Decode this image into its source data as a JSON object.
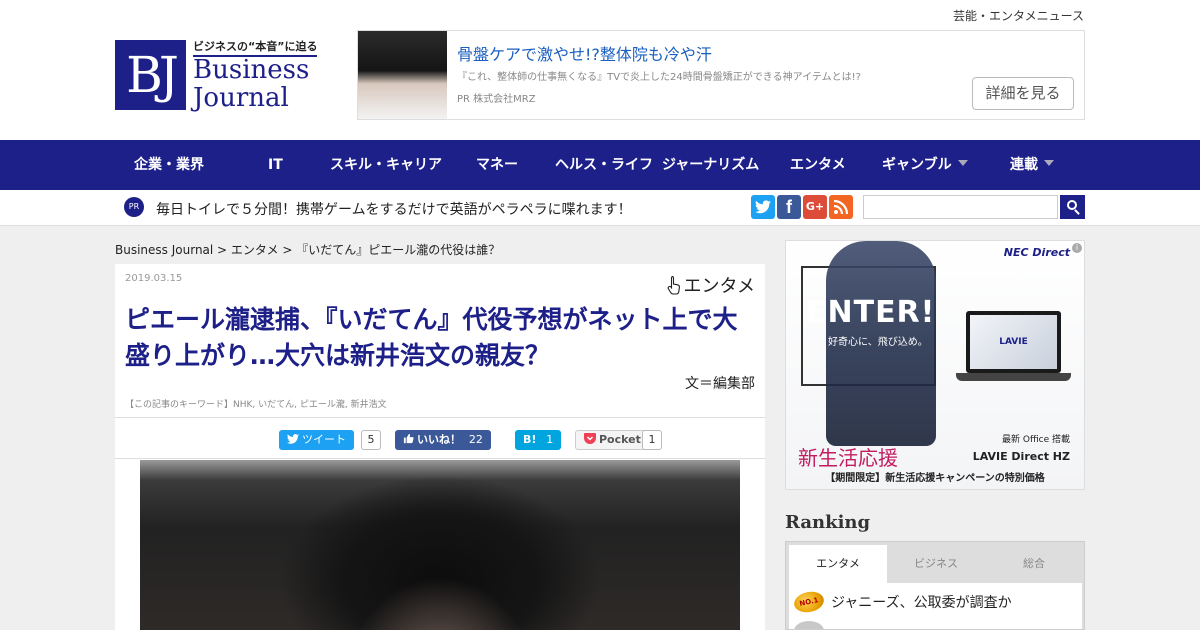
{
  "header": {
    "top_link": "芸能・エンタメニュース",
    "logo": {
      "mark": "BJ",
      "tagline": "ビジネスの“本音”に迫る",
      "name_line1": "Business",
      "name_line2": "Journal"
    }
  },
  "top_ad": {
    "headline": "骨盤ケアで激やせ!?整体院も冷や汗",
    "description": "『これ、整体師の仕事無くなる』TVで炎上した24時間骨盤矯正ができる神アイテムとは!?",
    "advertiser": "PR  株式会社MRZ",
    "button": "詳細を見る"
  },
  "nav": {
    "items": [
      {
        "label": "企業・業界"
      },
      {
        "label": "IT"
      },
      {
        "label": "スキル・キャリア"
      },
      {
        "label": "マネー"
      },
      {
        "label": "ヘルス・ライフ"
      },
      {
        "label": "ジャーナリズム"
      },
      {
        "label": "エンタメ"
      },
      {
        "label": "ギャンブル"
      },
      {
        "label": "連載"
      }
    ]
  },
  "subbar": {
    "pr_badge": "PR",
    "pr_text": "毎日トイレで５分間！携帯ゲームをするだけで英語がペラペラに喋れます！",
    "social": {
      "twitter": "t",
      "facebook": "f",
      "googleplus": "G+",
      "rss": "rss"
    },
    "search_placeholder": ""
  },
  "breadcrumb": "Business Journal  > エンタメ  >  『いだてん』ピエール瀧の代役は誰？",
  "article": {
    "date": "2019.03.15",
    "category": "エンタメ",
    "title": "ピエール瀧逮捕、『いだてん』代役予想がネット上で大盛り上がり…大穴は新井浩文の親友？",
    "byline": "文＝編集部",
    "keywords": "【この記事のキーワード】NHK, いだてん, ピエール瀧, 新井浩文",
    "share": {
      "tweet_label": "ツイート",
      "tweet_count": "5",
      "like_label": "いいね！",
      "like_count": "22",
      "hatena_label": "B!",
      "hatena_count": "1",
      "pocket_label": "Pocket",
      "pocket_count": "1"
    }
  },
  "side_ad": {
    "brand": "NEC Direct",
    "info": "i",
    "headline": "ENTER!",
    "sub": "好奇心に、飛び込め。",
    "laptop_logo": "LAVIE",
    "campaign": "新生活応援",
    "office": "最新 Office 搭載",
    "model": "LAVIE Direct HZ",
    "offer": "【期間限定】新生活応援キャンペーンの特別価格"
  },
  "ranking": {
    "title": "Ranking",
    "tabs": [
      {
        "label": "エンタメ"
      },
      {
        "label": "ビジネス"
      },
      {
        "label": "総合"
      }
    ],
    "items": [
      {
        "medal": "NO.1",
        "text": "ジャニーズ、公取委が調査か"
      }
    ]
  },
  "colors": {
    "brand_navy": "#1d2088",
    "link_blue": "#1a5fbf",
    "twitter": "#1da1f2",
    "facebook": "#3b5998",
    "googleplus": "#dd4b39",
    "rss": "#f26522",
    "hatena": "#00a4de",
    "pocket": "#ef4056"
  }
}
